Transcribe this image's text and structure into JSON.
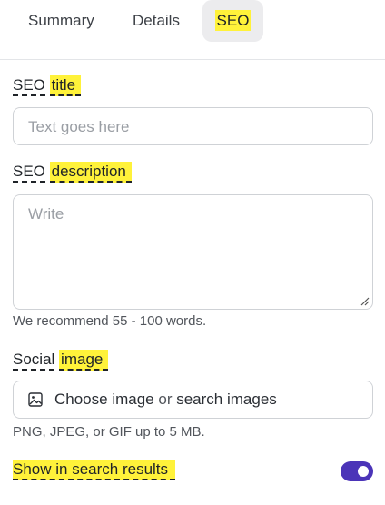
{
  "tabs": {
    "summary": "Summary",
    "details": "Details",
    "seo": "SEO"
  },
  "seo_title": {
    "label_plain": "SEO",
    "label_highlight": "title",
    "placeholder": "Text goes here"
  },
  "seo_description": {
    "label_plain": "SEO",
    "label_highlight": "description",
    "placeholder": "Write",
    "hint": "We recommend 55 - 100 words."
  },
  "social_image": {
    "label_plain": "Social",
    "label_highlight": "image",
    "choose": "Choose image",
    "or": "or",
    "search": "search images",
    "hint": "PNG, JPEG, or GIF up to 5 MB.",
    "icon": "image-icon"
  },
  "search_results": {
    "label": "Show in search results",
    "toggle_on": true
  },
  "colors": {
    "highlight": "#fff23a",
    "toggle": "#4b34b8",
    "active_tab_bg": "#ececee"
  }
}
